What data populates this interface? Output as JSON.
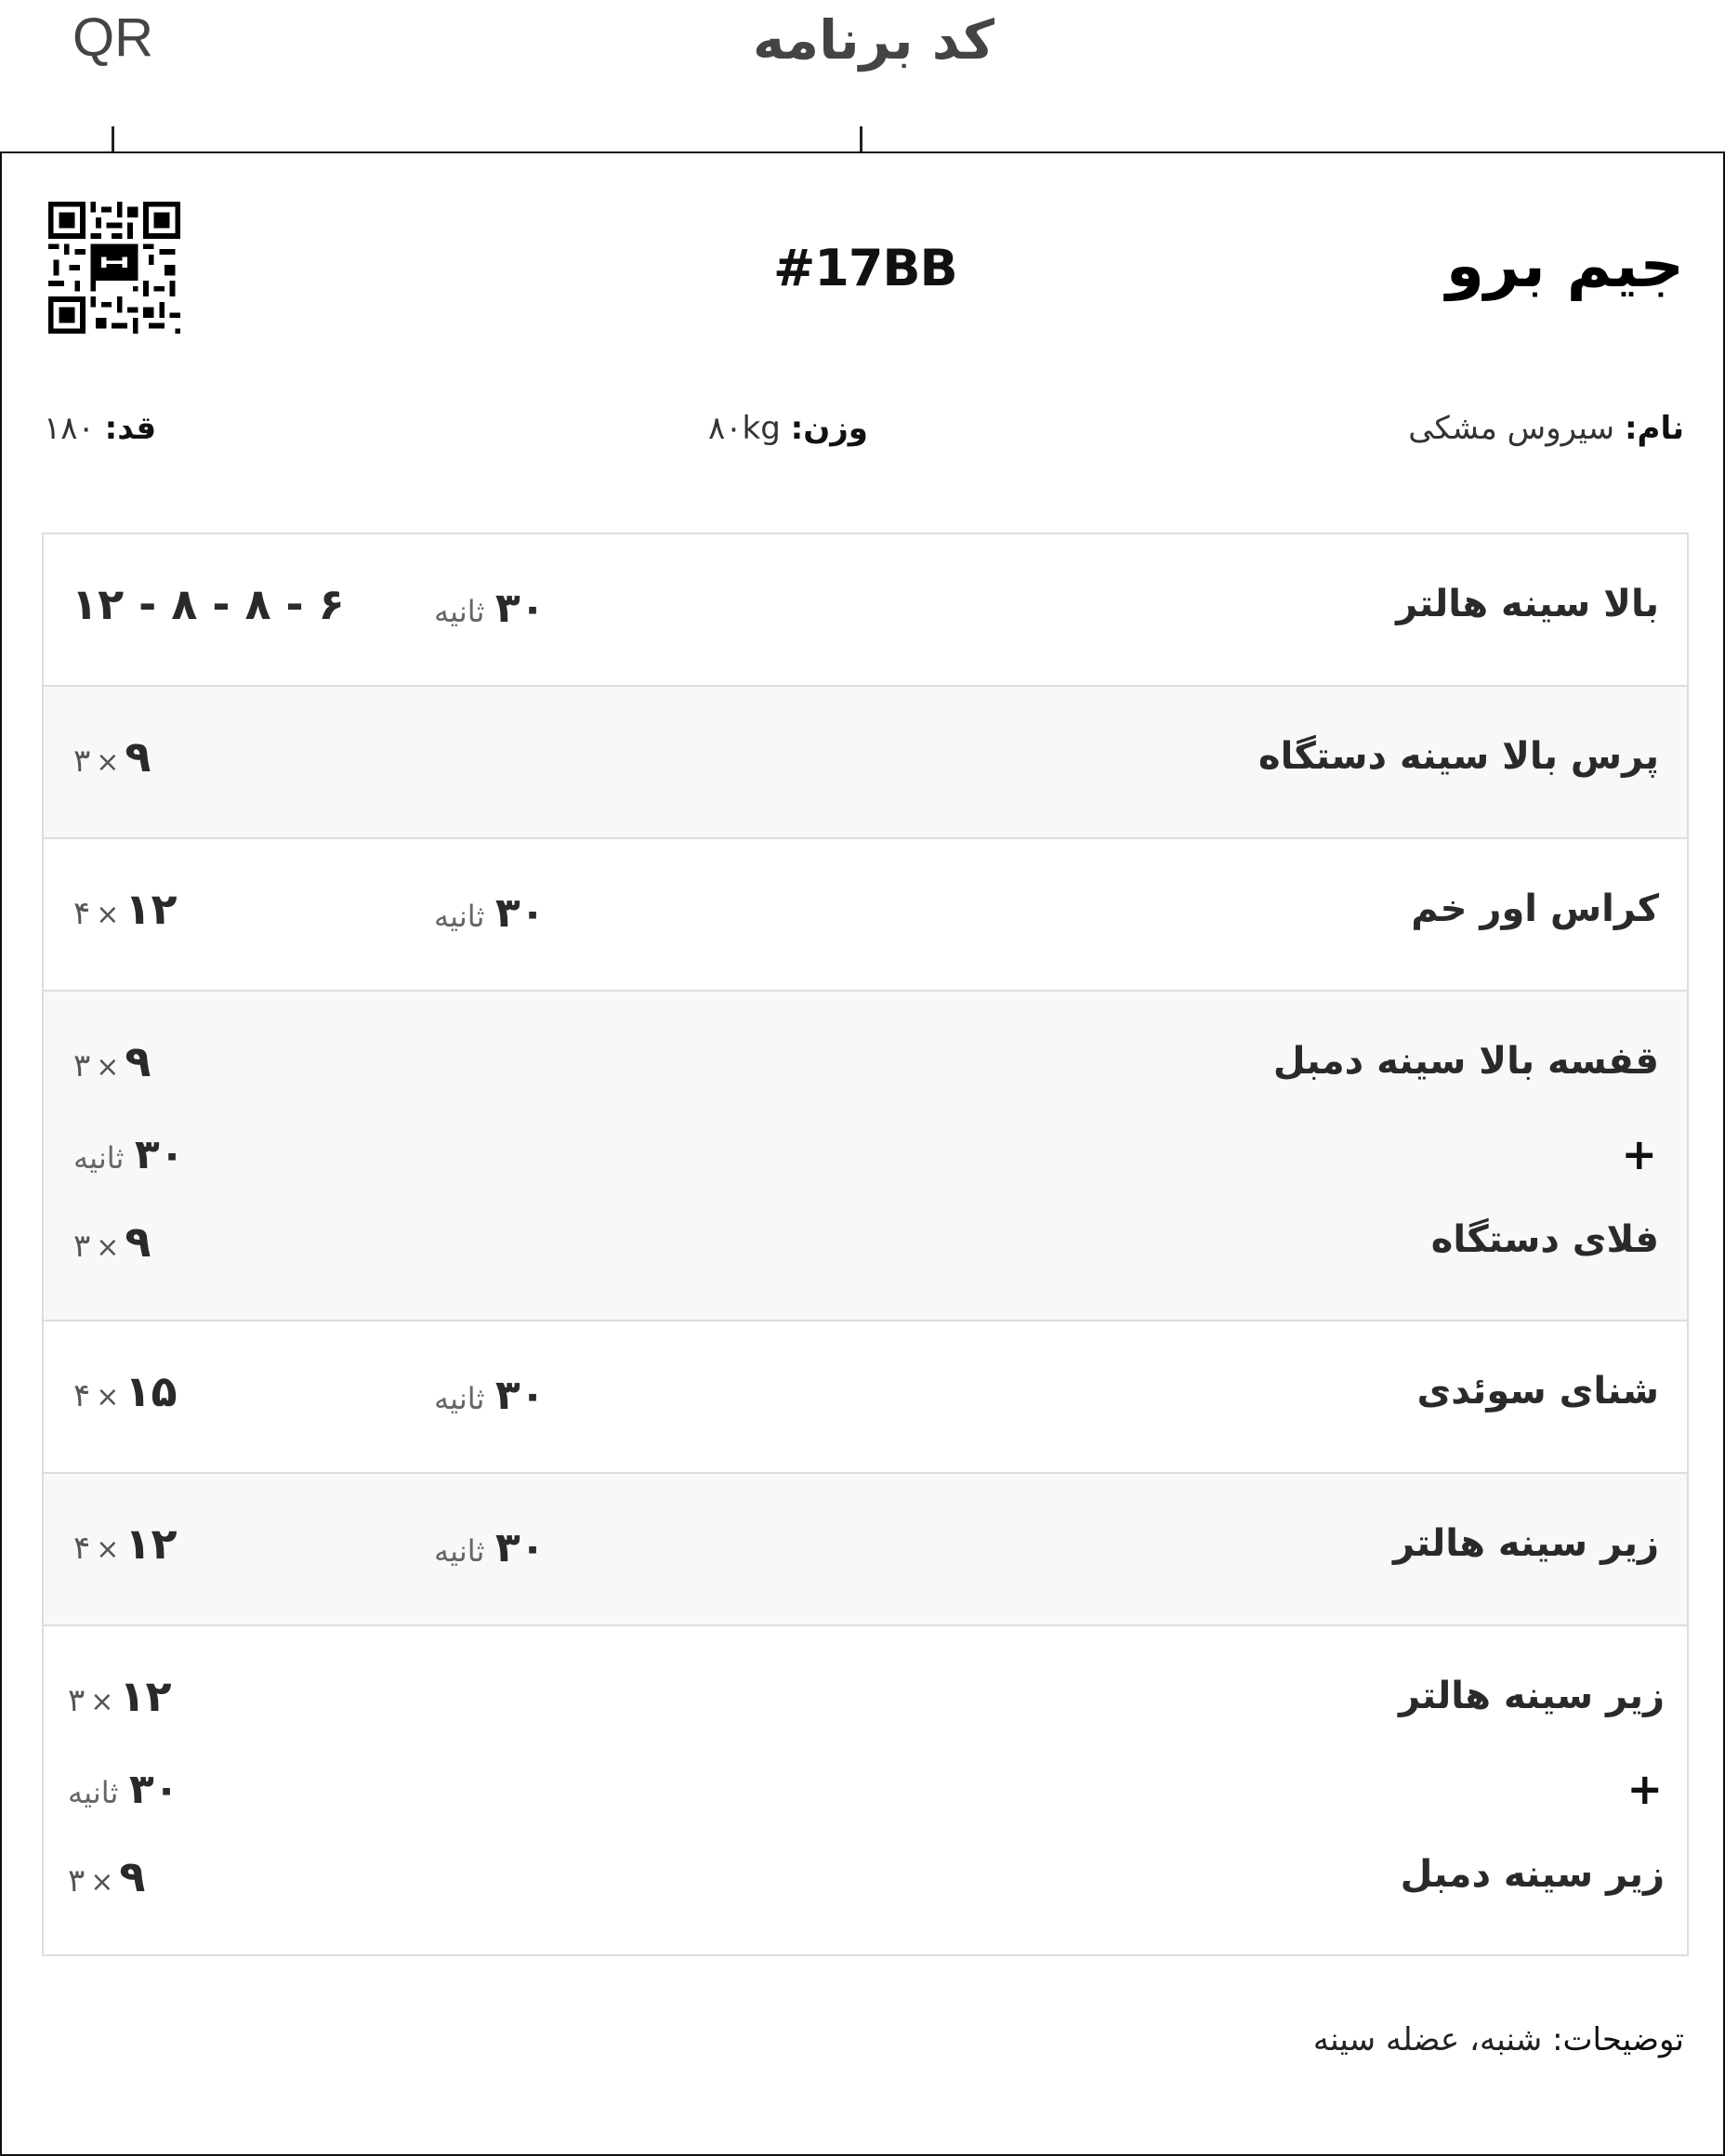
{
  "annotations": {
    "qr": "QR",
    "code": "کد برنامه"
  },
  "header": {
    "code": "#17BB",
    "brand": "جیم برو"
  },
  "info": {
    "name_label": "نام:",
    "name_value": "سیروس مشکی",
    "weight_label": "وزن:",
    "weight_value": "۸۰kg",
    "height_label": "قد:",
    "height_value": "۱۸۰"
  },
  "exercises": [
    {
      "name": "بالا سینه هالتر",
      "rest_num": "۳۰",
      "rest_unit": "ثانیه",
      "reps_seq": "۱۲ - ۸ - ۸ - ۶"
    },
    {
      "name": "پرس بالا سینه دستگاه",
      "sets": "۳",
      "reps": "۹"
    },
    {
      "name": "کراس اور خم",
      "rest_num": "۳۰",
      "rest_unit": "ثانیه",
      "sets": "۴",
      "reps": "۱۲"
    },
    {
      "superset": true,
      "a": {
        "name": "قفسه بالا سینه دمبل",
        "sets": "۳",
        "reps": "۹"
      },
      "plus": "+",
      "rest_num": "۳۰",
      "rest_unit": "ثانیه",
      "b": {
        "name": "فلای دستگاه",
        "sets": "۳",
        "reps": "۹"
      }
    },
    {
      "name": "شنای سوئدی",
      "rest_num": "۳۰",
      "rest_unit": "ثانیه",
      "sets": "۴",
      "reps": "۱۵"
    },
    {
      "name": "زیر سینه هالتر",
      "rest_num": "۳۰",
      "rest_unit": "ثانیه",
      "sets": "۴",
      "reps": "۱۲"
    },
    {
      "superset": true,
      "a": {
        "name": "زیر سینه هالتر",
        "sets": "۳",
        "reps": "۱۲"
      },
      "plus": "+",
      "rest_num": "۳۰",
      "rest_unit": "ثانیه",
      "b": {
        "name": "زیر سینه دمبل",
        "sets": "۳",
        "reps": "۹"
      }
    }
  ],
  "times_symbol": "×",
  "description": {
    "label": "توضیحات:",
    "value": "شنبه، عضله سینه"
  }
}
